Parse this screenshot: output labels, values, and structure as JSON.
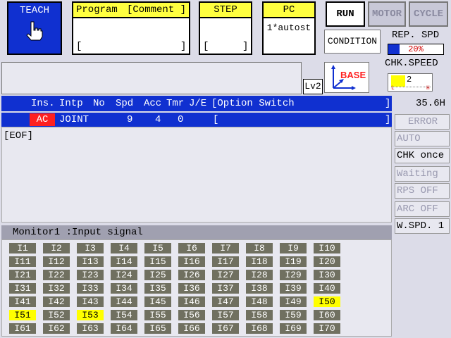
{
  "mode": {
    "teach_label": "TEACH"
  },
  "program": {
    "header_left": "Program",
    "header_right": "[Comment ]",
    "bracket_left": "[",
    "bracket_right": "]"
  },
  "step": {
    "header": "STEP",
    "bracket_left": "[",
    "bracket_right": "]"
  },
  "pc": {
    "header": "PC",
    "value": "1*autost"
  },
  "buttons": {
    "run": "RUN",
    "motor": "MOTOR",
    "cycle": "CYCLE",
    "condition": "CONDITION"
  },
  "rep_spd": {
    "label": "REP. SPD",
    "value": "20%",
    "fraction": 0.2
  },
  "chk_speed": {
    "label": "CHK.SPEED",
    "value": "2",
    "low": "L",
    "high": "H"
  },
  "level": "Lv2",
  "base_label": "BASE",
  "program_table": {
    "headers": [
      "Ins.",
      "Intp",
      "No",
      "Spd",
      "Acc",
      "Tmr",
      "J/E",
      "[Option Switch",
      "]"
    ],
    "row": {
      "ins": "AC",
      "intp": "JOINT",
      "spd": "9",
      "acc": "4",
      "tmr": "0",
      "opt_open": "[",
      "opt_close": "]"
    },
    "eof": "[EOF]"
  },
  "side": {
    "value": "35.6H",
    "items": [
      "ERROR",
      "AUTO",
      "CHK once",
      "Waiting",
      "RPS OFF",
      "ARC OFF",
      "W.SPD. 1"
    ]
  },
  "monitor": {
    "title": "Monitor1 :Input signal",
    "signals": [
      [
        "I1",
        "I2",
        "I3",
        "I4",
        "I5",
        "I6",
        "I7",
        "I8",
        "I9",
        "I10"
      ],
      [
        "I11",
        "I12",
        "I13",
        "I14",
        "I15",
        "I16",
        "I17",
        "I18",
        "I19",
        "I20"
      ],
      [
        "I21",
        "I22",
        "I23",
        "I24",
        "I25",
        "I26",
        "I27",
        "I28",
        "I29",
        "I30"
      ],
      [
        "I31",
        "I32",
        "I33",
        "I34",
        "I35",
        "I36",
        "I37",
        "I38",
        "I39",
        "I40"
      ],
      [
        "I41",
        "I42",
        "I43",
        "I44",
        "I45",
        "I46",
        "I47",
        "I48",
        "I49",
        "I50"
      ],
      [
        "I51",
        "I52",
        "I53",
        "I54",
        "I55",
        "I56",
        "I57",
        "I58",
        "I59",
        "I60"
      ],
      [
        "I61",
        "I62",
        "I63",
        "I64",
        "I65",
        "I66",
        "I67",
        "I68",
        "I69",
        "I70"
      ]
    ],
    "active": [
      "I50",
      "I51",
      "I53"
    ]
  }
}
